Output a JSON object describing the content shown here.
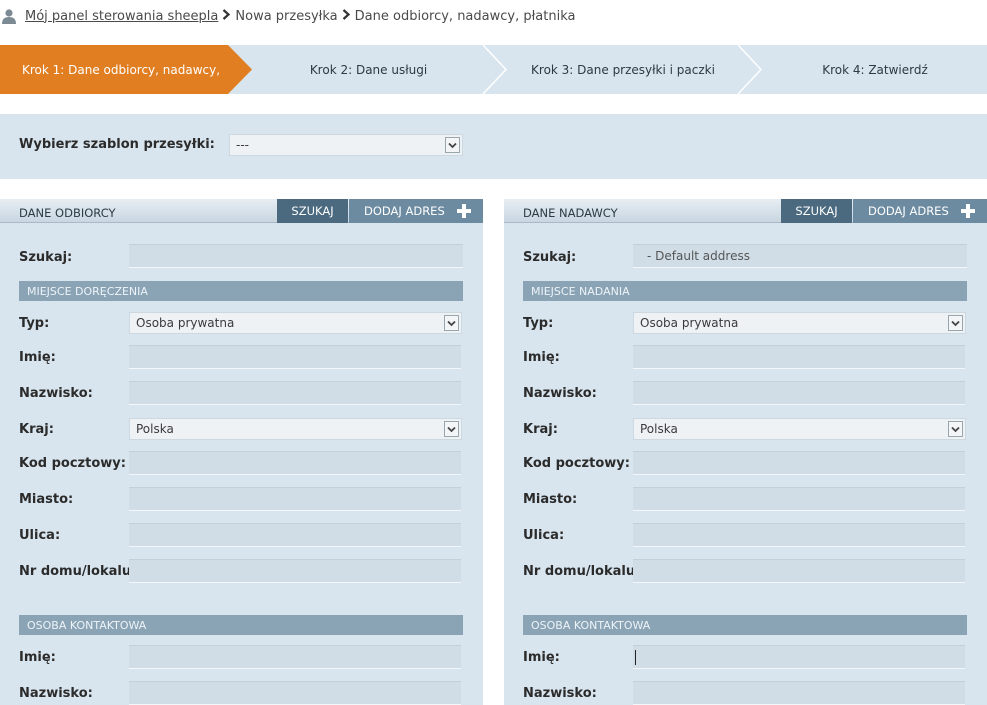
{
  "breadcrumb": {
    "home": "Mój panel sterowania sheepla",
    "step2": "Nowa przesyłka",
    "step3": "Dane odbiorcy, nadawcy, płatnika"
  },
  "steps": [
    {
      "label": "Krok 1: Dane odbiorcy, nadawcy,",
      "active": true
    },
    {
      "label": "Krok 2: Dane usługi",
      "active": false
    },
    {
      "label": "Krok 3: Dane przesyłki i paczki",
      "active": false
    },
    {
      "label": "Krok 4: Zatwierdź",
      "active": false
    }
  ],
  "template": {
    "label": "Wybierz szablon przesyłki:",
    "value": "---"
  },
  "recipient": {
    "title": "DANE ODBIORCY",
    "search_btn": "SZUKAJ",
    "add_btn": "DODAJ ADRES",
    "search_label": "Szukaj:",
    "search_value": "",
    "place_section": "MIEJSCE DORĘCZENIA",
    "fields": {
      "type_label": "Typ:",
      "type_value": "Osoba prywatna",
      "first_label": "Imię:",
      "first_value": "",
      "last_label": "Nazwisko:",
      "last_value": "",
      "country_label": "Kraj:",
      "country_value": "Polska",
      "zip_label": "Kod pocztowy:",
      "zip_value": "",
      "city_label": "Miasto:",
      "city_value": "",
      "street_label": "Ulica:",
      "street_value": "",
      "house_label": "Nr domu/lokalu:",
      "house_value": ""
    },
    "contact_section": "OSOBA KONTAKTOWA",
    "contact": {
      "first_label": "Imię:",
      "first_value": "",
      "last_label": "Nazwisko:",
      "last_value": ""
    }
  },
  "sender": {
    "title": "DANE NADAWCY",
    "search_btn": "SZUKAJ",
    "add_btn": "DODAJ ADRES",
    "search_label": "Szukaj:",
    "search_value": "- Default address",
    "place_section": "MIEJSCE NADANIA",
    "fields": {
      "type_label": "Typ:",
      "type_value": "Osoba prywatna",
      "first_label": "Imię:",
      "first_value": "",
      "last_label": "Nazwisko:",
      "last_value": "",
      "country_label": "Kraj:",
      "country_value": "Polska",
      "zip_label": "Kod pocztowy:",
      "zip_value": "",
      "city_label": "Miasto:",
      "city_value": "",
      "street_label": "Ulica:",
      "street_value": "",
      "house_label": "Nr domu/lokalu:",
      "house_value": ""
    },
    "contact_section": "OSOBA KONTAKTOWA",
    "contact": {
      "first_label": "Imię:",
      "first_value": "",
      "last_label": "Nazwisko:",
      "last_value": ""
    }
  },
  "colors": {
    "accent": "#e07e21",
    "panel_bg": "#d8e5ee",
    "button_dark": "#4b6a80",
    "button_light": "#6c8ba1",
    "section_bar": "#8aa3b5"
  }
}
